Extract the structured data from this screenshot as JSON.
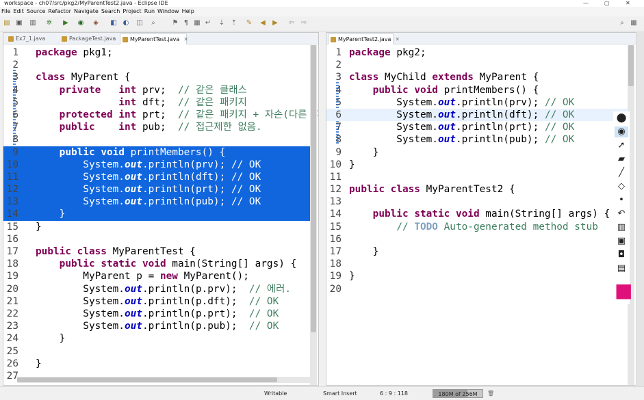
{
  "window": {
    "title": "workspace - ch07/src/pkg2/MyParentTest2.java - Eclipse IDE",
    "controls": [
      "—",
      "▢",
      "✕"
    ]
  },
  "menu": [
    "File",
    "Edit",
    "Source",
    "Refactor",
    "Navigate",
    "Search",
    "Project",
    "Run",
    "Window",
    "Help"
  ],
  "left_editor": {
    "tabs": [
      {
        "label": "Ex7_1.java",
        "close": "",
        "active": false
      },
      {
        "label": "PackageTest.java",
        "close": "",
        "active": false
      },
      {
        "label": "MyParentTest.java",
        "close": "✕",
        "active": true
      }
    ],
    "lines": [
      {
        "n": "1",
        "text": "package pkg1;"
      },
      {
        "n": "2",
        "text": ""
      },
      {
        "n": "3",
        "text": "class MyParent {"
      },
      {
        "n": "4",
        "text": "    private   int prv;  // 같은 클래스"
      },
      {
        "n": "5",
        "text": "              int dft;  // 같은 패키지"
      },
      {
        "n": "6",
        "text": "    protected int prt;  // 같은 패키지 + 자손(다른 패키"
      },
      {
        "n": "7",
        "text": "    public    int pub;  // 접근제한 없음."
      },
      {
        "n": "8",
        "text": ""
      },
      {
        "n": "9",
        "text": "    public void printMembers() {"
      },
      {
        "n": "10",
        "text": "        System.out.println(prv); // OK"
      },
      {
        "n": "11",
        "text": "        System.out.println(dft); // OK"
      },
      {
        "n": "12",
        "text": "        System.out.println(prt); // OK"
      },
      {
        "n": "13",
        "text": "        System.out.println(pub); // OK"
      },
      {
        "n": "14",
        "text": "    }"
      },
      {
        "n": "15",
        "text": "}"
      },
      {
        "n": "16",
        "text": ""
      },
      {
        "n": "17",
        "text": "public class MyParentTest {"
      },
      {
        "n": "18",
        "text": "    public static void main(String[] args) {"
      },
      {
        "n": "19",
        "text": "        MyParent p = new MyParent();"
      },
      {
        "n": "20",
        "text": "        System.out.println(p.prv);  // 에러."
      },
      {
        "n": "21",
        "text": "        System.out.println(p.dft);  // OK"
      },
      {
        "n": "22",
        "text": "        System.out.println(p.prt);  // OK"
      },
      {
        "n": "23",
        "text": "        System.out.println(p.pub);  // OK"
      },
      {
        "n": "24",
        "text": "    }"
      },
      {
        "n": "25",
        "text": ""
      },
      {
        "n": "26",
        "text": "}"
      },
      {
        "n": "27",
        "text": ""
      }
    ]
  },
  "right_editor": {
    "tabs": [
      {
        "label": "MyParentTest2.java",
        "close": "✕",
        "active": true
      }
    ],
    "lines": [
      {
        "n": "1",
        "text": "package pkg2;"
      },
      {
        "n": "2",
        "text": ""
      },
      {
        "n": "3",
        "text": "class MyChild extends MyParent {"
      },
      {
        "n": "4",
        "text": "    public void printMembers() {"
      },
      {
        "n": "5",
        "text": "        System.out.println(prv); // OK"
      },
      {
        "n": "6",
        "text": "        System.out.println(dft); // OK"
      },
      {
        "n": "7",
        "text": "        System.out.println(prt); // OK"
      },
      {
        "n": "8",
        "text": "        System.out.println(pub); // OK"
      },
      {
        "n": "9",
        "text": "    }"
      },
      {
        "n": "10",
        "text": "}"
      },
      {
        "n": "11",
        "text": ""
      },
      {
        "n": "12",
        "text": "public class MyParentTest2 {"
      },
      {
        "n": "13",
        "text": ""
      },
      {
        "n": "14",
        "text": "    public static void main(String[] args) {"
      },
      {
        "n": "15",
        "text": "        // TODO Auto-generated method stub"
      },
      {
        "n": "16",
        "text": ""
      },
      {
        "n": "17",
        "text": "    }"
      },
      {
        "n": "18",
        "text": ""
      },
      {
        "n": "19",
        "text": "}"
      },
      {
        "n": "20",
        "text": ""
      }
    ]
  },
  "status": {
    "writable": "Writable",
    "insert_mode": "Smart Insert",
    "position": "6 : 9 : 118",
    "heap": "180M of 256M",
    "heap_used_fraction": 0.7
  },
  "colors": {
    "keyword": "#7f0055",
    "comment": "#3f7f5f",
    "field": "#0000c0",
    "selection": "#1166dd",
    "todo": "#7f9fbf"
  },
  "annotation_toolbar_icons": [
    "map-pin-icon",
    "eye-icon",
    "pointer-icon",
    "highlighter-icon",
    "pen-icon",
    "eraser-icon",
    "dot-icon",
    "undo-icon",
    "trash-icon",
    "stamp-icon",
    "camera-icon",
    "clipboard-icon",
    "color-palette-icon"
  ]
}
